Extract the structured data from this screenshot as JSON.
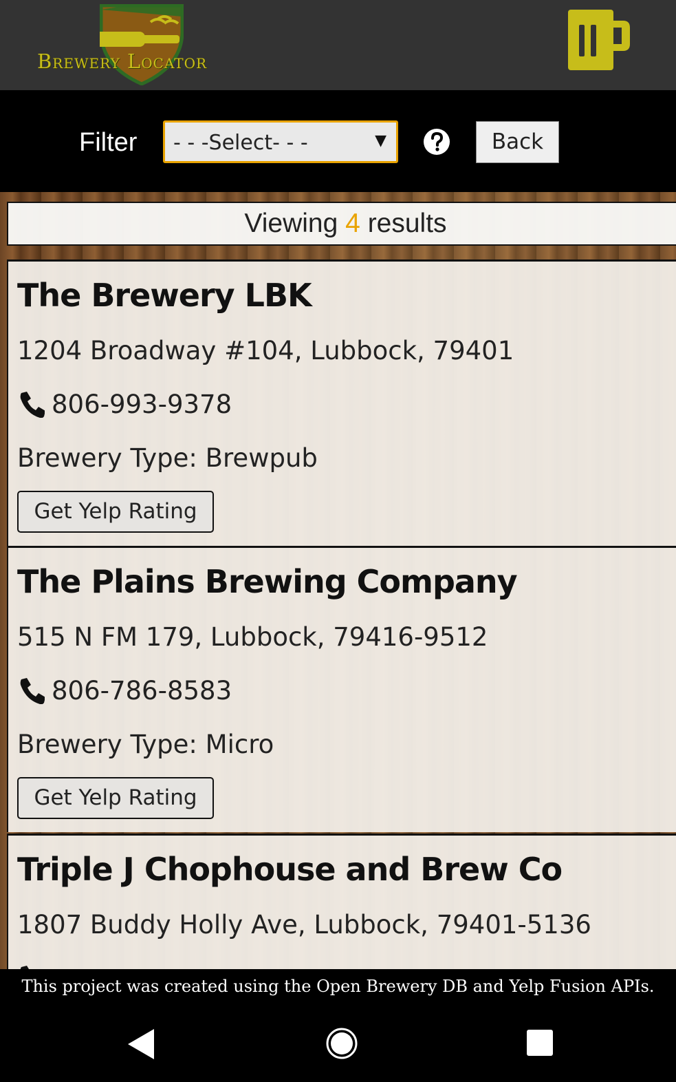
{
  "header": {
    "logo_text": "Brewery Locator",
    "logo_icon": "beer-bottle-shield-logo",
    "menu_icon": "beer-mug-icon",
    "colors": {
      "background": "#333333",
      "logo_gold": "#c7bd1a",
      "accent": "#e9a300"
    }
  },
  "filter": {
    "label": "Filter",
    "selected": "- - -Select- - -",
    "help_icon": "question-circle-icon",
    "back_label": "Back"
  },
  "results": {
    "prefix": "Viewing",
    "count": "4",
    "suffix": "results"
  },
  "breweries": [
    {
      "name": "The Brewery LBK",
      "address": "1204 Broadway #104, Lubbock, 79401",
      "phone": "806-993-9378",
      "type": "Brewery Type: Brewpub",
      "button": "Get Yelp Rating"
    },
    {
      "name": "The Plains Brewing Company",
      "address": "515 N FM 179, Lubbock, 79416-9512",
      "phone": "806-786-8583",
      "type": "Brewery Type: Micro",
      "button": "Get Yelp Rating"
    },
    {
      "name": "Triple J Chophouse and Brew Co",
      "address": "1807 Buddy Holly Ave, Lubbock, 79401-5136",
      "phone": "",
      "type": "",
      "button": ""
    }
  ],
  "footer": {
    "text": "This project was created using the Open Brewery DB and Yelp Fusion APIs."
  },
  "system_nav": {
    "back_icon": "nav-back-triangle-icon",
    "home_icon": "nav-home-circle-icon",
    "recents_icon": "nav-recents-square-icon"
  }
}
